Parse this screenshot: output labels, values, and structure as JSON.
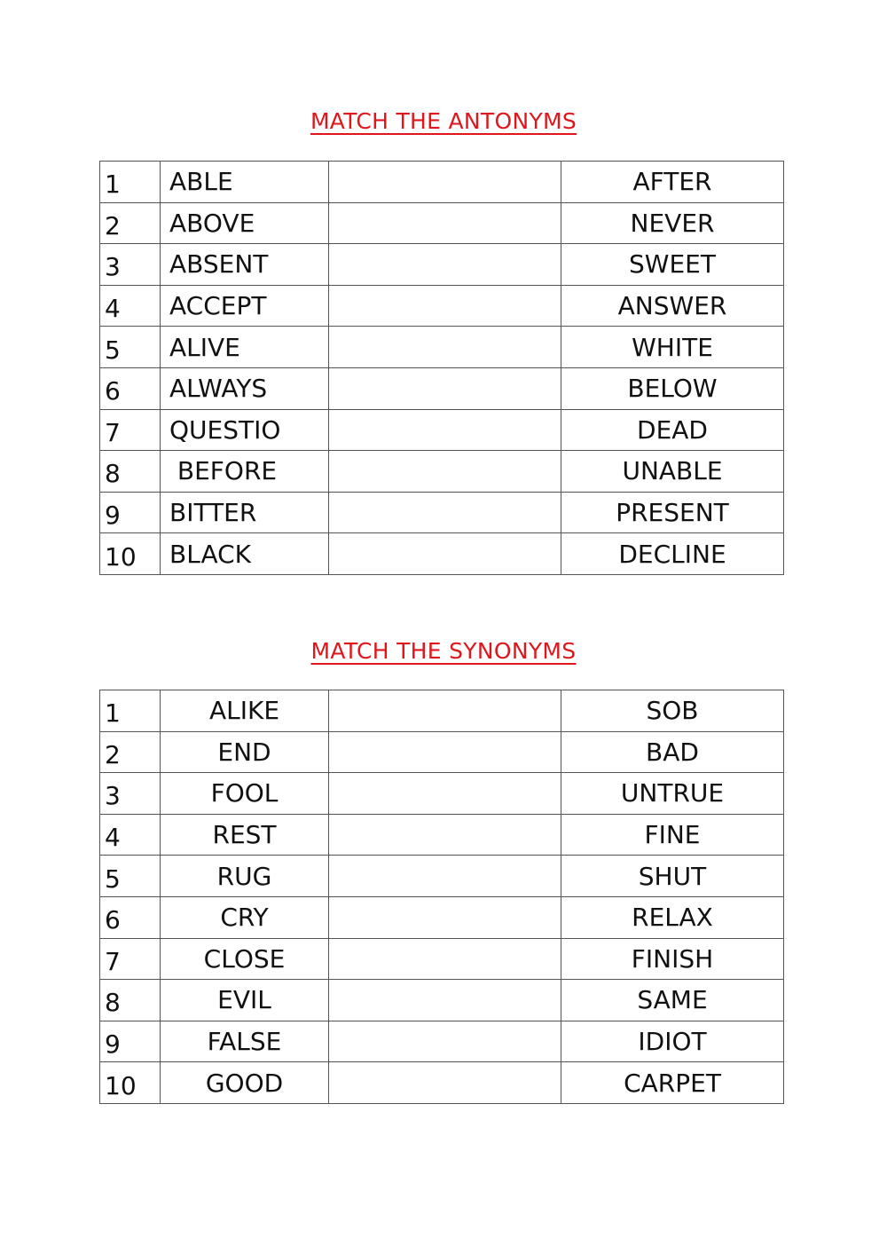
{
  "antonyms": {
    "title": "MATCH THE ANTONYMS",
    "rows": [
      {
        "n": "1",
        "word": "ABLE",
        "match": "AFTER"
      },
      {
        "n": "2",
        "word": "ABOVE",
        "match": "NEVER"
      },
      {
        "n": "3",
        "word": "ABSENT",
        "match": "SWEET"
      },
      {
        "n": "4",
        "word": "ACCEPT",
        "match": "ANSWER"
      },
      {
        "n": "5",
        "word": "ALIVE",
        "match": "WHITE"
      },
      {
        "n": "6",
        "word": "ALWAYS",
        "match": "BELOW"
      },
      {
        "n": "7",
        "word": "QUESTIO",
        "match": "DEAD"
      },
      {
        "n": "8",
        "word": " BEFORE",
        "match": "UNABLE"
      },
      {
        "n": "9",
        "word": "BITTER",
        "match": "PRESENT"
      },
      {
        "n": "10",
        "word": "BLACK",
        "match": "DECLINE"
      }
    ]
  },
  "synonyms": {
    "title": "MATCH THE SYNONYMS",
    "rows": [
      {
        "n": "1",
        "word": "ALIKE",
        "match": "SOB"
      },
      {
        "n": "2",
        "word": "END",
        "match": "BAD"
      },
      {
        "n": "3",
        "word": "FOOL",
        "match": "UNTRUE"
      },
      {
        "n": "4",
        "word": "REST",
        "match": "FINE"
      },
      {
        "n": "5",
        "word": "RUG",
        "match": "SHUT"
      },
      {
        "n": "6",
        "word": "CRY",
        "match": "RELAX"
      },
      {
        "n": "7",
        "word": "CLOSE",
        "match": "FINISH"
      },
      {
        "n": "8",
        "word": "EVIL",
        "match": "SAME"
      },
      {
        "n": "9",
        "word": "FALSE",
        "match": "IDIOT"
      },
      {
        "n": "10",
        "word": "GOOD",
        "match": "CARPET"
      }
    ]
  },
  "colors": {
    "title": "#e0161c",
    "text": "#111111",
    "border": "#555555"
  }
}
